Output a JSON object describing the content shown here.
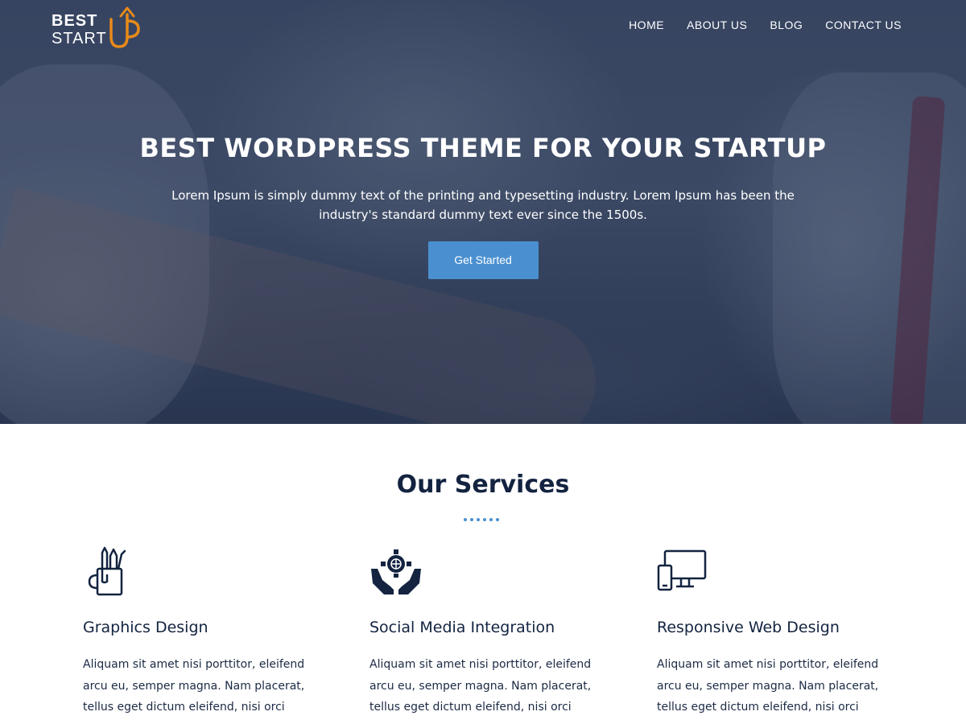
{
  "brand": {
    "line1": "BEST",
    "line2": "START",
    "accent": "#e88a1a"
  },
  "nav": {
    "items": [
      "HOME",
      "ABOUT US",
      "BLOG",
      "CONTACT US"
    ]
  },
  "hero": {
    "title": "BEST WORDPRESS THEME FOR YOUR STARTUP",
    "text": "Lorem Ipsum is simply dummy text of the printing and typesetting industry. Lorem Ipsum has been the industry's standard dummy text ever since the 1500s.",
    "button": "Get Started",
    "button_color": "#4a90d0"
  },
  "services": {
    "title": "Our Services",
    "items": [
      {
        "icon": "pencil-cup-icon",
        "title": "Graphics Design",
        "text": "Aliquam sit amet nisi porttitor, eleifend arcu eu, semper magna. Nam placerat, tellus eget dictum eleifend, nisi orci"
      },
      {
        "icon": "hands-globe-gear-icon",
        "title": "Social Media Integration",
        "text": "Aliquam sit amet nisi porttitor, eleifend arcu eu, semper magna. Nam placerat, tellus eget dictum eleifend, nisi orci"
      },
      {
        "icon": "devices-icon",
        "title": "Responsive Web Design",
        "text": "Aliquam sit amet nisi porttitor, eleifend arcu eu, semper magna. Nam placerat, tellus eget dictum eleifend, nisi orci"
      }
    ]
  }
}
